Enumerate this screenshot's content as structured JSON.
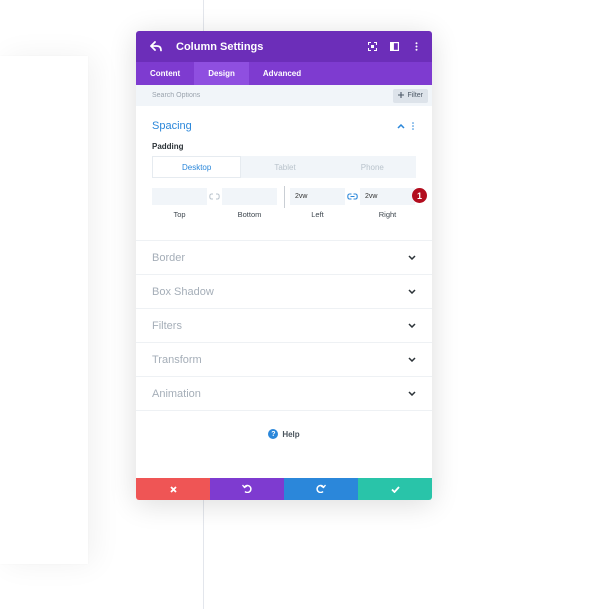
{
  "modal": {
    "title": "Column Settings",
    "colors": {
      "header": "#6c2eb9",
      "tabs": "#7e3bd0",
      "active_tab": "#8f4fe0",
      "accent": "#2b87da",
      "cancel": "#ef5555",
      "undo": "#7e3bd0",
      "redo": "#2b87da",
      "save": "#29c4a9",
      "badge": "#b20d1e"
    },
    "header_icons": [
      "back-arrow-icon",
      "expand-icon",
      "sidebar-toggle-icon",
      "more-vertical-icon"
    ]
  },
  "tabs": [
    {
      "label": "Content",
      "active": false
    },
    {
      "label": "Design",
      "active": true
    },
    {
      "label": "Advanced",
      "active": false
    }
  ],
  "search": {
    "placeholder": "Search Options",
    "filter_label": "Filter",
    "filter_icon": "plus-icon"
  },
  "spacing": {
    "title": "Spacing",
    "padding_label": "Padding",
    "device_tabs": [
      "Desktop",
      "Tablet",
      "Phone"
    ],
    "active_device": "Desktop",
    "fields": {
      "top": {
        "label": "Top",
        "value": ""
      },
      "bottom": {
        "label": "Bottom",
        "value": ""
      },
      "left": {
        "label": "Left",
        "value": "2vw"
      },
      "right": {
        "label": "Right",
        "value": "2vw"
      }
    },
    "badge": "1"
  },
  "sections": [
    {
      "title": "Border"
    },
    {
      "title": "Box Shadow"
    },
    {
      "title": "Filters"
    },
    {
      "title": "Transform"
    },
    {
      "title": "Animation"
    }
  ],
  "help": {
    "label": "Help",
    "icon": "question-icon"
  },
  "footer_icons": [
    "close-icon",
    "undo-icon",
    "redo-icon",
    "check-icon"
  ]
}
